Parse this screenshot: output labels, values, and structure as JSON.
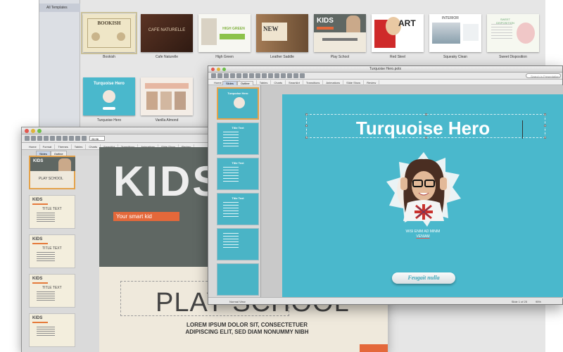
{
  "gallery": {
    "sidebar_item": "All Templates",
    "templates": [
      {
        "label": "Bookish",
        "thumb_title": "BOOKISH"
      },
      {
        "label": "Cafe Naturelle",
        "thumb_title": "CAFE NATURELLE"
      },
      {
        "label": "High Green",
        "thumb_title": "HIGH GREEN"
      },
      {
        "label": "Leather Saddle",
        "thumb_title": "NEW"
      },
      {
        "label": "Play School",
        "thumb_title": "KIDS"
      },
      {
        "label": "Red Steel",
        "thumb_title": "ART"
      },
      {
        "label": "Squeaky Clean",
        "thumb_title": "INTERIOR"
      },
      {
        "label": "Sweet Disposition",
        "thumb_title": "SWEET DISPOSITION"
      },
      {
        "label": "Turquoise Hero",
        "thumb_title": "Turquoise Hero"
      },
      {
        "label": "Vanilla Almond",
        "thumb_title": ""
      }
    ]
  },
  "kids_window": {
    "view_tabs": [
      "Slides",
      "Outline"
    ],
    "ribbon_tabs": [
      "Home",
      "Format",
      "Themes",
      "Tables",
      "Charts",
      "SmartArt",
      "Transitions",
      "Animations",
      "Slide Show",
      "Review"
    ],
    "zoom": "28.96",
    "thumb_kids": "KIDS",
    "thumb_play": "PLAY SCHOOL",
    "thumb_title": "TITLE TEXT",
    "slide_heading": "KIDS",
    "slide_sub": "Your smart kid",
    "slide_title": "PLAY SCHOOL",
    "slide_body": "LOREM IPSUM DOLOR SIT, CONSECTETUER ADIPISCING ELIT, SED DIAM NONUMMY NIBH"
  },
  "turq_window": {
    "title": "Turquoise Hero.potx",
    "search_placeholder": "Search in Presentation",
    "ribbon_tabs": [
      "Home",
      "Format",
      "Themes",
      "Tables",
      "Charts",
      "SmartArt",
      "Transitions",
      "Animations",
      "Slide Show",
      "Review"
    ],
    "view_tabs": [
      "Slides",
      "Outline"
    ],
    "thumb_titles": [
      "Turquoise Hero",
      "Title Text",
      "Title Text",
      "Title Text",
      "",
      ""
    ],
    "slide_title": "Turquoise Hero",
    "slide_sub1": "WISI ENIM AD MINIM",
    "slide_sub2": "VENIAM",
    "button_text": "Feugait nulla",
    "status_view": "Normal View",
    "status_slide": "Slide 1 of 25",
    "status_zoom": "95%"
  },
  "colors": {
    "turquoise": "#4ab8cc",
    "kids_orange": "#e4683a",
    "kids_dark": "#5f6763"
  }
}
